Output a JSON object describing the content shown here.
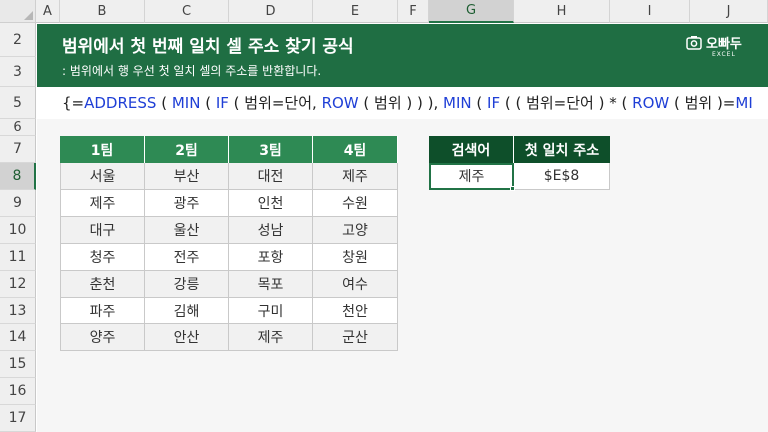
{
  "columns": [
    "A",
    "B",
    "C",
    "D",
    "E",
    "F",
    "G",
    "H",
    "I",
    "J"
  ],
  "rows": [
    "2",
    "3",
    "5",
    "6",
    "7",
    "8",
    "9",
    "10",
    "11",
    "12",
    "13",
    "14",
    "15",
    "16",
    "17"
  ],
  "selected_column": "G",
  "selected_row": "8",
  "banner": {
    "title": "범위에서 첫 번째 일치 셀 주소 찾기 공식",
    "subtitle": ": 범위에서 행 우선 첫 일치 셀의 주소를 반환합니다.",
    "logo": "오빠두",
    "logo_sub": "EXCEL"
  },
  "formula": {
    "p1": "{=",
    "f1": "ADDRESS",
    "p2": " ( ",
    "f2": "MIN",
    "p3": " ( ",
    "f3": "IF",
    "p4": " ( 범위=단어, ",
    "f4": "ROW",
    "p5": " ( 범위 ) ) ), ",
    "f5": "MIN",
    "p6": " ( ",
    "f6": "IF",
    "p7": " ( ( 범위=단어 ) * ( ",
    "f7": "ROW",
    "p8": " ( 범위 )=",
    "f8": "MI"
  },
  "team_table": {
    "headers": [
      "1팀",
      "2팀",
      "3팀",
      "4팀"
    ],
    "rows": [
      [
        "서울",
        "부산",
        "대전",
        "제주"
      ],
      [
        "제주",
        "광주",
        "인천",
        "수원"
      ],
      [
        "대구",
        "울산",
        "성남",
        "고양"
      ],
      [
        "청주",
        "전주",
        "포항",
        "창원"
      ],
      [
        "춘천",
        "강릉",
        "목포",
        "여수"
      ],
      [
        "파주",
        "김해",
        "구미",
        "천안"
      ],
      [
        "양주",
        "안산",
        "제주",
        "군산"
      ]
    ]
  },
  "search_table": {
    "headers": [
      "검색어",
      "첫 일치 주소"
    ],
    "row": [
      "제주",
      "$E$8"
    ]
  },
  "colors": {
    "banner_bg": "#1f6e43",
    "header_green": "#2e8a54",
    "header_dark": "#0e4f2a",
    "formula_function": "#1f3fd6",
    "selection": "#217346"
  }
}
